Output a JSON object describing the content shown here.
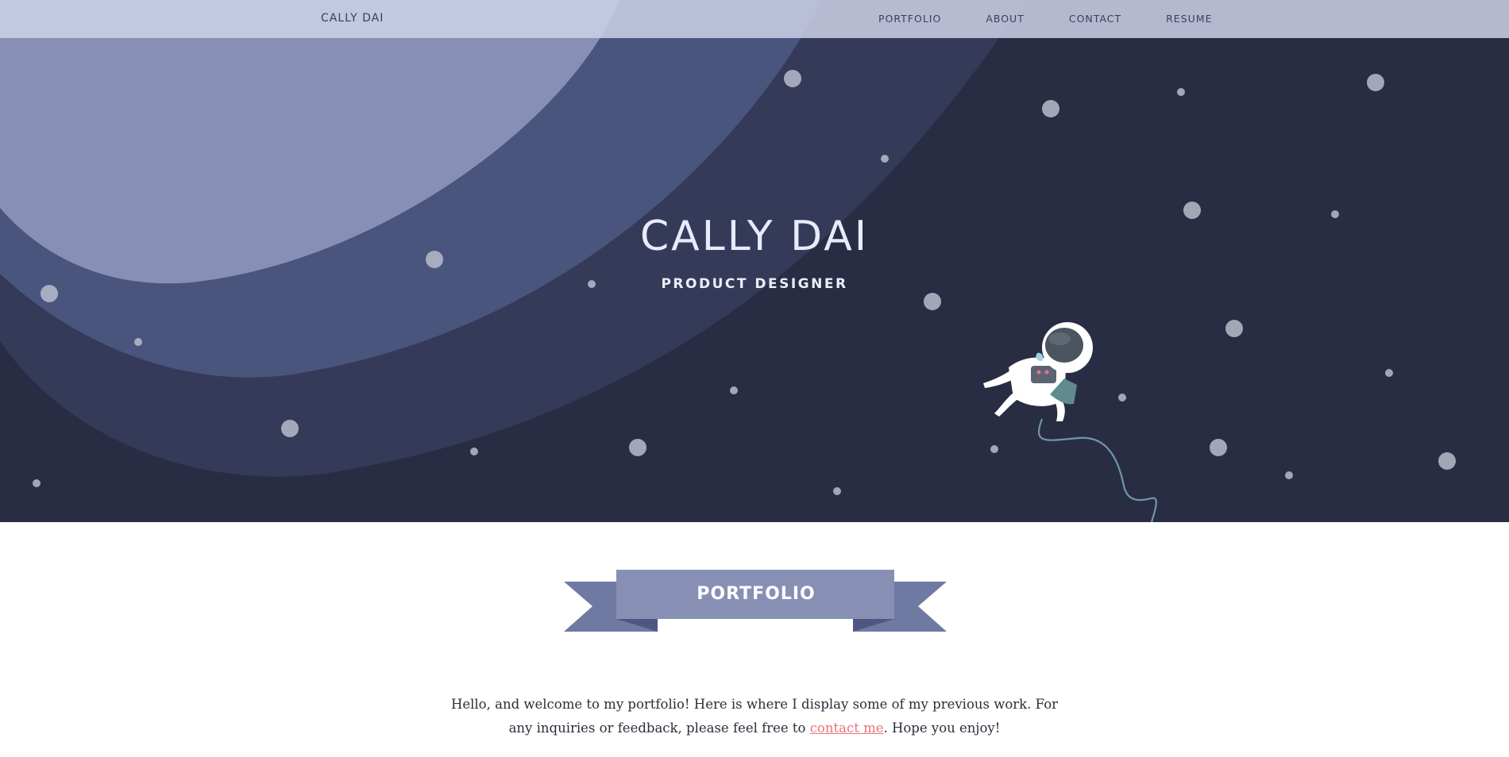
{
  "nav": {
    "brand": "CALLY DAI",
    "links": [
      "PORTFOLIO",
      "ABOUT",
      "CONTACT",
      "RESUME"
    ]
  },
  "hero": {
    "title": "CALLY DAI",
    "subtitle": "PRODUCT DESIGNER"
  },
  "section": {
    "banner_label": "PORTFOLIO",
    "intro_before": "Hello, and welcome to my portfolio! Here is where I display some of my previous work. For any inquiries or feedback, please feel free to ",
    "intro_link": "contact me",
    "intro_after": ". Hope you enjoy!"
  },
  "colors": {
    "space": "#292d43",
    "planet_ring_1": "#353a58",
    "planet_ring_2": "#4a557e",
    "planet_core": "#8790b4",
    "nav_bg": "#cdd2e8",
    "banner_main": "#8790b4",
    "banner_tails": "#6e7aa2",
    "link": "#e8747a"
  },
  "icons": {
    "astronaut": "astronaut-illustration",
    "stars": "star-dot"
  }
}
